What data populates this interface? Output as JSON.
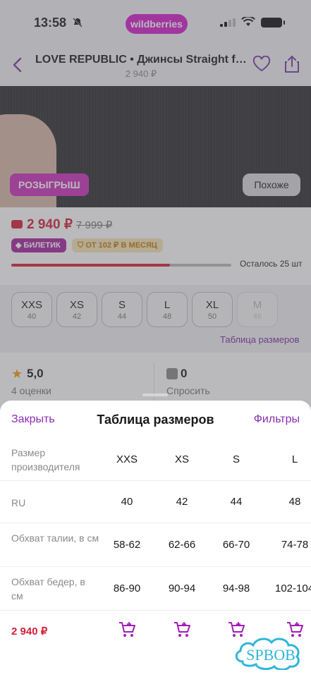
{
  "status": {
    "time": "13:58",
    "brand": "wildberries"
  },
  "header": {
    "title": "LOVE REPUBLIC • Джинсы Straight fi...",
    "price": "2 940 ₽"
  },
  "hero": {
    "raffle": "РОЗЫГРЫШ",
    "similar": "Похоже"
  },
  "price_block": {
    "price": "2 940 ₽",
    "old_price": "7 999 ₽",
    "ticket": "БИЛЕТИК",
    "installment": "ОТ 102 ₽ В МЕСЯЦ",
    "stock_label": "Осталось 25 шт",
    "stock_level": 0.72
  },
  "sizes": [
    {
      "size": "XXS",
      "ru": "40"
    },
    {
      "size": "XS",
      "ru": "42"
    },
    {
      "size": "S",
      "ru": "44"
    },
    {
      "size": "L",
      "ru": "48"
    },
    {
      "size": "XL",
      "ru": "50"
    },
    {
      "size": "M",
      "ru": "46"
    }
  ],
  "size_table_link": "Таблица размеров",
  "rating": {
    "value": "5,0",
    "count": "4 оценки",
    "questions": "0",
    "ask": "Спросить"
  },
  "sheet": {
    "close": "Закрыть",
    "title": "Таблица размеров",
    "filters": "Фильтры",
    "rows": [
      {
        "label": "Размер производителя",
        "cells": [
          "XXS",
          "XS",
          "S",
          "L"
        ]
      },
      {
        "label": "RU",
        "cells": [
          "40",
          "42",
          "44",
          "48"
        ]
      },
      {
        "label": "Обхват талии, в см",
        "cells": [
          "58-62",
          "62-66",
          "66-70",
          "74-78"
        ]
      },
      {
        "label": "Обхват бедер, в см",
        "cells": [
          "86-90",
          "90-94",
          "94-98",
          "102-104"
        ]
      }
    ],
    "price": "2 940 ₽"
  },
  "watermark": "SPBOB",
  "colors": {
    "accent": "#8a2fb3",
    "price": "#d3203a",
    "brand": "#d41ccd"
  }
}
